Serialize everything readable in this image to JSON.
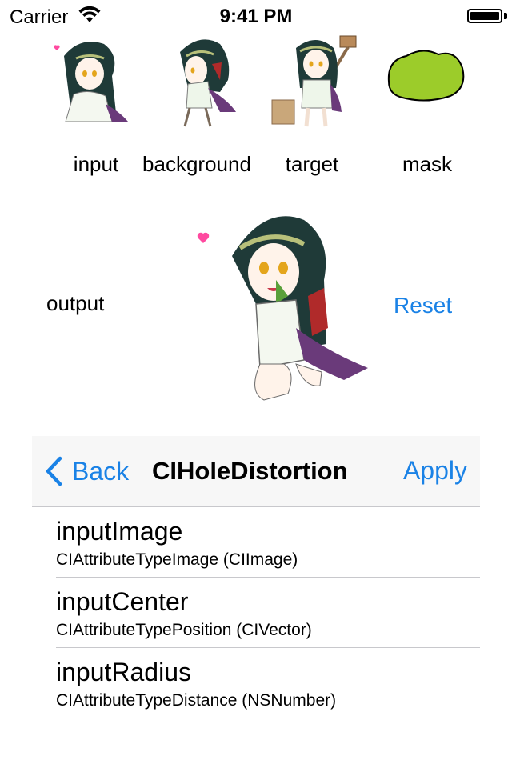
{
  "status_bar": {
    "carrier": "Carrier",
    "time": "9:41 PM",
    "battery_level": 1.0
  },
  "thumbnails": [
    {
      "label": "input"
    },
    {
      "label": "background"
    },
    {
      "label": "target"
    },
    {
      "label": "mask"
    }
  ],
  "output": {
    "label": "output",
    "reset_label": "Reset"
  },
  "navbar": {
    "back_label": "Back",
    "title": "CIHoleDistortion",
    "apply_label": "Apply"
  },
  "attributes": [
    {
      "name": "inputImage",
      "type": "CIAttributeTypeImage (CIImage)"
    },
    {
      "name": "inputCenter",
      "type": "CIAttributeTypePosition (CIVector)"
    },
    {
      "name": "inputRadius",
      "type": "CIAttributeTypeDistance (NSNumber)"
    }
  ],
  "colors": {
    "accent": "#1a82e6",
    "mask": "#9ccc2a",
    "hair": "#1f3a38"
  }
}
